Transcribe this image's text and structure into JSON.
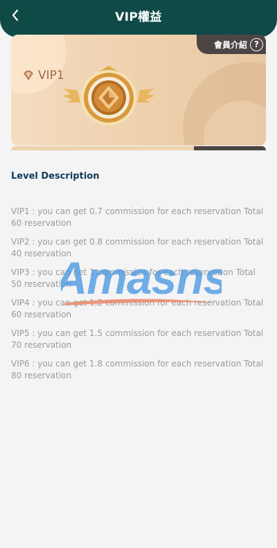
{
  "header": {
    "title": "VIP權益"
  },
  "card": {
    "member_intro_label": "會員介紹",
    "help_symbol": "?",
    "vip_level": "VIP1",
    "colors": {
      "card": "#efd2b0",
      "tag": "#4d4444",
      "level_text": "#a06b48"
    }
  },
  "section": {
    "title": "Level Description"
  },
  "levels": [
    "VIP1 : you can get 0.7 commission for each reservation Total 60 reservation",
    "VIP2 : you can get 0.8 commission for each reservation Total 40 reservation",
    "VIP3 : you can get 1 commission for each reservation Total 50 reservation",
    "VIP4 : you can get 1.2 commission for each reservation Total 60 reservation",
    "VIP5 : you can get 1.5 commission for each reservation Total 70 reservation",
    "VIP6 : you can get 1.8 commission for each reservation Total 80 reservation"
  ],
  "watermark": {
    "text": "Amasns"
  },
  "colors": {
    "header": "#0f4a47",
    "background": "#f4f4f5",
    "section_title": "#123a55",
    "body_text": "#9a9a9a"
  }
}
